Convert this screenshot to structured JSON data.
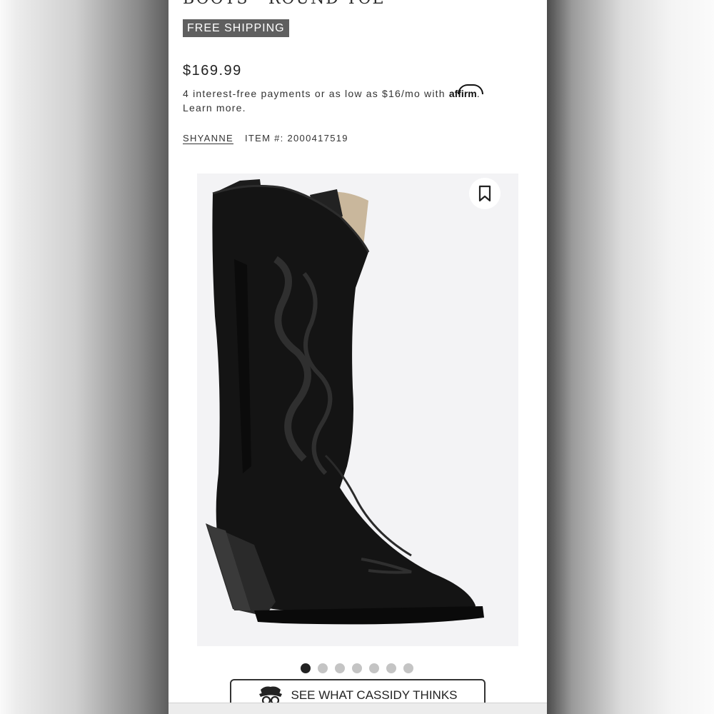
{
  "product": {
    "title": "BOOTS - ROUND TOE",
    "badge": "FREE SHIPPING",
    "price": "$169.99",
    "installments_text": "4 interest-free payments or as low as $16/mo with",
    "affirm_label": "affirm",
    "period": ".",
    "learn_more": "Learn more.",
    "brand": "SHYANNE",
    "item_label": "ITEM #: 2000417519"
  },
  "gallery": {
    "image_alt": "black cowboy boot",
    "save_icon": "bookmark-icon",
    "current_index": 1,
    "total_images": 7
  },
  "cta": {
    "icon": "cowboy-hat-logo-icon",
    "label": "SEE WHAT CASSIDY THINKS"
  },
  "colors": {
    "badge_bg": "#5f5f5f",
    "dot_active": "#222222",
    "dot_inactive": "#c4c4c4"
  }
}
